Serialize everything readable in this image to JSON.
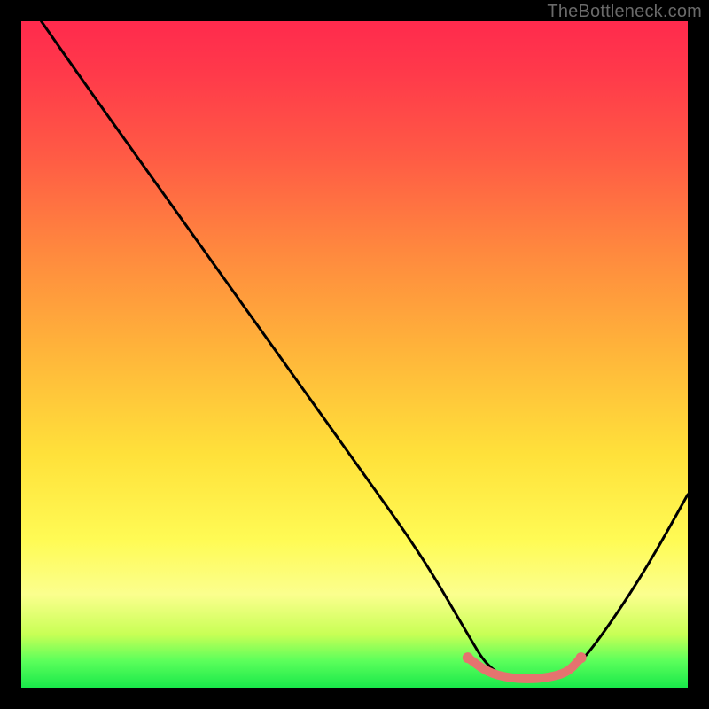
{
  "watermark": "TheBottleneck.com",
  "chart_data": {
    "type": "line",
    "title": "",
    "xlabel": "",
    "ylabel": "",
    "xlim": [
      0,
      100
    ],
    "ylim": [
      0,
      100
    ],
    "grid": false,
    "legend": false,
    "series": [
      {
        "name": "bottleneck-curve",
        "color": "#000000",
        "x": [
          3,
          10,
          20,
          30,
          40,
          50,
          60,
          67,
          70,
          74,
          78,
          82,
          85,
          90,
          95,
          100
        ],
        "y": [
          100,
          90,
          76,
          62,
          48,
          34,
          20,
          8,
          3,
          1,
          1,
          2,
          5,
          12,
          20,
          29
        ]
      },
      {
        "name": "optimal-band",
        "color": "#e5736f",
        "x": [
          67,
          70,
          73,
          76,
          79,
          82,
          84
        ],
        "y": [
          4.5,
          2.3,
          1.5,
          1.3,
          1.5,
          2.3,
          4.5
        ]
      }
    ],
    "background_gradient": {
      "stops": [
        {
          "pos": 0.0,
          "color": "#ff2a4d"
        },
        {
          "pos": 0.5,
          "color": "#ffb63a"
        },
        {
          "pos": 0.8,
          "color": "#fffb55"
        },
        {
          "pos": 1.0,
          "color": "#19e84a"
        }
      ]
    }
  }
}
